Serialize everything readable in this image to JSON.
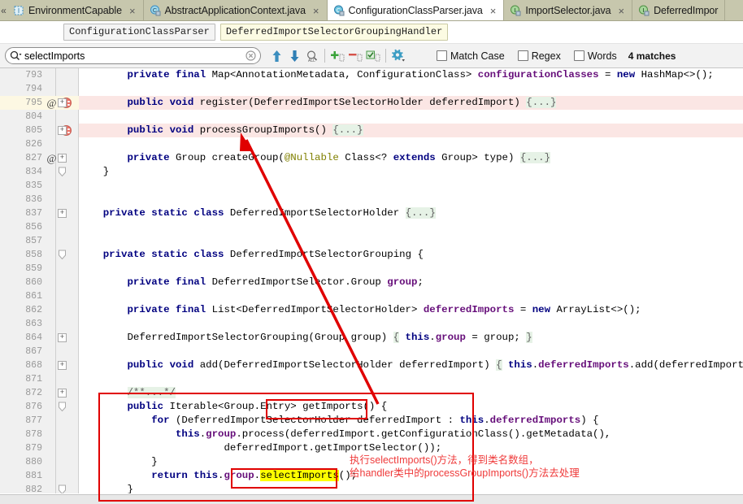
{
  "window": {
    "app": "IntelliJ IDEA Editor",
    "file": "ConfigurationClassParser.java"
  },
  "tabbar": {
    "overflow_left": "«",
    "tabs": [
      {
        "label": "EnvironmentCapable",
        "icon": "interface-icon",
        "active": false,
        "close": "×"
      },
      {
        "label": "AbstractApplicationContext.java",
        "icon": "class-icon",
        "active": false,
        "close": "×"
      },
      {
        "label": "ConfigurationClassParser.java",
        "icon": "class-icon",
        "active": true,
        "close": "×"
      },
      {
        "label": "ImportSelector.java",
        "icon": "interface-icon",
        "active": false,
        "close": "×"
      },
      {
        "label": "DeferredImpor",
        "icon": "interface-icon",
        "active": false,
        "close": ""
      }
    ]
  },
  "breadcrumb": {
    "items": [
      {
        "label": "ConfigurationClassParser",
        "highlight": false
      },
      {
        "label": "DeferredImportSelectorGroupingHandler",
        "highlight": true
      }
    ]
  },
  "findbar": {
    "search_value": "selectImports",
    "search_placeholder": "Search",
    "clear_title": "Clear",
    "buttons": [
      {
        "name": "find-previous-button",
        "glyph": "↑"
      },
      {
        "name": "find-next-button",
        "glyph": "↓"
      },
      {
        "name": "find-all-button",
        "glyph": "ALL"
      },
      {
        "name": "add-occurrence-button",
        "glyph": "+"
      },
      {
        "name": "remove-occurrence-button",
        "glyph": "−"
      },
      {
        "name": "select-all-occurrences-button",
        "glyph": "✓"
      },
      {
        "name": "find-settings-button",
        "glyph": "⚙"
      }
    ],
    "options": [
      {
        "label": "Match Case",
        "checked": false,
        "accesskey": "C"
      },
      {
        "label": "Regex",
        "checked": false,
        "accesskey": "g"
      },
      {
        "label": "Words",
        "checked": false,
        "accesskey": "r"
      }
    ],
    "match_count": "4 matches"
  },
  "editor": {
    "colors": {
      "keyword": "#000080",
      "field": "#660e7a",
      "annotation": "#808000",
      "folded": "#e6f2e6",
      "caret_row": "#fdf8e3",
      "modified_row": "#fbe6e4",
      "search_hit": "#ffff00",
      "annotation_red": "#ef3b3b"
    },
    "lines": [
      {
        "num": "793",
        "at": false,
        "override": false,
        "fold": "",
        "caret": false,
        "pinkbg": 0,
        "tokens": [
          {
            "t": "        ",
            "c": "plain"
          },
          {
            "t": "private",
            "c": "kw"
          },
          {
            "t": " ",
            "c": "plain"
          },
          {
            "t": "final",
            "c": "kw"
          },
          {
            "t": " Map<AnnotationMetadata, ConfigurationClass> ",
            "c": "plain"
          },
          {
            "t": "configurationClasses",
            "c": "fld"
          },
          {
            "t": " = ",
            "c": "plain"
          },
          {
            "t": "new",
            "c": "kw"
          },
          {
            "t": " HashMap<>();",
            "c": "plain"
          }
        ]
      },
      {
        "num": "794",
        "at": false,
        "override": false,
        "fold": "",
        "caret": false,
        "pinkbg": 0,
        "tokens": []
      },
      {
        "num": "795",
        "at": true,
        "override": true,
        "fold": "+",
        "caret": true,
        "pinkbg": 817,
        "tokens": [
          {
            "t": "        ",
            "c": "plain"
          },
          {
            "t": "public",
            "c": "kw"
          },
          {
            "t": " ",
            "c": "plain"
          },
          {
            "t": "void",
            "c": "kw"
          },
          {
            "t": " register(DeferredImportSelectorHolder deferredImport) ",
            "c": "plain"
          },
          {
            "t": "{...}",
            "c": "fold-ph"
          }
        ]
      },
      {
        "num": "804",
        "at": false,
        "override": false,
        "fold": "",
        "caret": false,
        "pinkbg": 0,
        "tokens": []
      },
      {
        "num": "805",
        "at": false,
        "override": true,
        "fold": "+",
        "caret": false,
        "pinkbg": 817,
        "tokens": [
          {
            "t": "        ",
            "c": "plain"
          },
          {
            "t": "public",
            "c": "kw"
          },
          {
            "t": " ",
            "c": "plain"
          },
          {
            "t": "void",
            "c": "kw"
          },
          {
            "t": " processGroupImports() ",
            "c": "plain"
          },
          {
            "t": "{...}",
            "c": "fold-ph"
          }
        ]
      },
      {
        "num": "826",
        "at": false,
        "override": false,
        "fold": "",
        "caret": false,
        "pinkbg": 0,
        "tokens": []
      },
      {
        "num": "827",
        "at": true,
        "override": false,
        "fold": "+",
        "caret": false,
        "pinkbg": 0,
        "tokens": [
          {
            "t": "        ",
            "c": "plain"
          },
          {
            "t": "private",
            "c": "kw"
          },
          {
            "t": " Group createGroup(",
            "c": "plain"
          },
          {
            "t": "@Nullable",
            "c": "anno"
          },
          {
            "t": " Class<? ",
            "c": "plain"
          },
          {
            "t": "extends",
            "c": "kw"
          },
          {
            "t": " Group> type) ",
            "c": "plain"
          },
          {
            "t": "{...}",
            "c": "fold-ph"
          }
        ]
      },
      {
        "num": "834",
        "at": false,
        "override": false,
        "fold": "collapse",
        "caret": false,
        "pinkbg": 0,
        "tokens": [
          {
            "t": "    }",
            "c": "plain"
          }
        ]
      },
      {
        "num": "835",
        "at": false,
        "override": false,
        "fold": "",
        "caret": false,
        "pinkbg": 0,
        "tokens": []
      },
      {
        "num": "836",
        "at": false,
        "override": false,
        "fold": "",
        "caret": false,
        "pinkbg": 0,
        "tokens": []
      },
      {
        "num": "837",
        "at": false,
        "override": false,
        "fold": "+",
        "caret": false,
        "pinkbg": 0,
        "tokens": [
          {
            "t": "    ",
            "c": "plain"
          },
          {
            "t": "private",
            "c": "kw"
          },
          {
            "t": " ",
            "c": "plain"
          },
          {
            "t": "static",
            "c": "kw"
          },
          {
            "t": " ",
            "c": "plain"
          },
          {
            "t": "class",
            "c": "kw"
          },
          {
            "t": " DeferredImportSelectorHolder ",
            "c": "plain"
          },
          {
            "t": "{...}",
            "c": "fold-ph"
          }
        ]
      },
      {
        "num": "856",
        "at": false,
        "override": false,
        "fold": "",
        "caret": false,
        "pinkbg": 0,
        "tokens": []
      },
      {
        "num": "857",
        "at": false,
        "override": false,
        "fold": "",
        "caret": false,
        "pinkbg": 0,
        "tokens": []
      },
      {
        "num": "858",
        "at": false,
        "override": false,
        "fold": "collapse",
        "caret": false,
        "pinkbg": 0,
        "tokens": [
          {
            "t": "    ",
            "c": "plain"
          },
          {
            "t": "private",
            "c": "kw"
          },
          {
            "t": " ",
            "c": "plain"
          },
          {
            "t": "static",
            "c": "kw"
          },
          {
            "t": " ",
            "c": "plain"
          },
          {
            "t": "class",
            "c": "kw"
          },
          {
            "t": " DeferredImportSelectorGrouping {",
            "c": "plain"
          }
        ]
      },
      {
        "num": "859",
        "at": false,
        "override": false,
        "fold": "",
        "caret": false,
        "pinkbg": 0,
        "tokens": []
      },
      {
        "num": "860",
        "at": false,
        "override": false,
        "fold": "",
        "caret": false,
        "pinkbg": 0,
        "tokens": [
          {
            "t": "        ",
            "c": "plain"
          },
          {
            "t": "private",
            "c": "kw"
          },
          {
            "t": " ",
            "c": "plain"
          },
          {
            "t": "final",
            "c": "kw"
          },
          {
            "t": " DeferredImportSelector.Group ",
            "c": "plain"
          },
          {
            "t": "group",
            "c": "fld"
          },
          {
            "t": ";",
            "c": "plain"
          }
        ]
      },
      {
        "num": "861",
        "at": false,
        "override": false,
        "fold": "",
        "caret": false,
        "pinkbg": 0,
        "tokens": []
      },
      {
        "num": "862",
        "at": false,
        "override": false,
        "fold": "",
        "caret": false,
        "pinkbg": 0,
        "tokens": [
          {
            "t": "        ",
            "c": "plain"
          },
          {
            "t": "private",
            "c": "kw"
          },
          {
            "t": " ",
            "c": "plain"
          },
          {
            "t": "final",
            "c": "kw"
          },
          {
            "t": " List<DeferredImportSelectorHolder> ",
            "c": "plain"
          },
          {
            "t": "deferredImports",
            "c": "fld"
          },
          {
            "t": " = ",
            "c": "plain"
          },
          {
            "t": "new",
            "c": "kw"
          },
          {
            "t": " ArrayList<>();",
            "c": "plain"
          }
        ]
      },
      {
        "num": "863",
        "at": false,
        "override": false,
        "fold": "",
        "caret": false,
        "pinkbg": 0,
        "tokens": []
      },
      {
        "num": "864",
        "at": false,
        "override": false,
        "fold": "+",
        "caret": false,
        "pinkbg": 0,
        "tokens": [
          {
            "t": "        DeferredImportSelectorGrouping(Group group) ",
            "c": "plain"
          },
          {
            "t": "{",
            "c": "fold-ph"
          },
          {
            "t": " ",
            "c": "plain"
          },
          {
            "t": "this",
            "c": "kw"
          },
          {
            "t": ".",
            "c": "plain"
          },
          {
            "t": "group",
            "c": "fld"
          },
          {
            "t": " = group; ",
            "c": "plain"
          },
          {
            "t": "}",
            "c": "fold-ph"
          }
        ]
      },
      {
        "num": "867",
        "at": false,
        "override": false,
        "fold": "",
        "caret": false,
        "pinkbg": 0,
        "tokens": []
      },
      {
        "num": "868",
        "at": false,
        "override": false,
        "fold": "+",
        "caret": false,
        "pinkbg": 0,
        "tokens": [
          {
            "t": "        ",
            "c": "plain"
          },
          {
            "t": "public",
            "c": "kw"
          },
          {
            "t": " ",
            "c": "plain"
          },
          {
            "t": "void",
            "c": "kw"
          },
          {
            "t": " add(DeferredImportSelectorHolder deferredImport) ",
            "c": "plain"
          },
          {
            "t": "{",
            "c": "fold-ph"
          },
          {
            "t": " ",
            "c": "plain"
          },
          {
            "t": "this",
            "c": "kw"
          },
          {
            "t": ".",
            "c": "plain"
          },
          {
            "t": "deferredImports",
            "c": "fld"
          },
          {
            "t": ".add(deferredImport); ",
            "c": "plain"
          },
          {
            "t": "}",
            "c": "fold-ph"
          }
        ]
      },
      {
        "num": "871",
        "at": false,
        "override": false,
        "fold": "",
        "caret": false,
        "pinkbg": 0,
        "tokens": []
      },
      {
        "num": "872",
        "at": false,
        "override": false,
        "fold": "+",
        "caret": false,
        "pinkbg": 0,
        "tokens": [
          {
            "t": "        ",
            "c": "plain"
          },
          {
            "t": "/**...*/",
            "c": "fold-ph"
          }
        ]
      },
      {
        "num": "876",
        "at": false,
        "override": false,
        "fold": "collapse",
        "caret": false,
        "pinkbg": 0,
        "tokens": [
          {
            "t": "        ",
            "c": "plain"
          },
          {
            "t": "public",
            "c": "kw"
          },
          {
            "t": " Iterable<Group.Entry> getImports() {",
            "c": "plain"
          }
        ]
      },
      {
        "num": "877",
        "at": false,
        "override": false,
        "fold": "",
        "caret": false,
        "pinkbg": 0,
        "tokens": [
          {
            "t": "            ",
            "c": "plain"
          },
          {
            "t": "for",
            "c": "kw"
          },
          {
            "t": " (DeferredImportSelectorHolder deferredImport : ",
            "c": "plain"
          },
          {
            "t": "this",
            "c": "kw"
          },
          {
            "t": ".",
            "c": "plain"
          },
          {
            "t": "deferredImports",
            "c": "fld"
          },
          {
            "t": ") {",
            "c": "plain"
          }
        ]
      },
      {
        "num": "878",
        "at": false,
        "override": false,
        "fold": "",
        "caret": false,
        "pinkbg": 0,
        "tokens": [
          {
            "t": "                ",
            "c": "plain"
          },
          {
            "t": "this",
            "c": "kw"
          },
          {
            "t": ".",
            "c": "plain"
          },
          {
            "t": "group",
            "c": "fld"
          },
          {
            "t": ".process(deferredImport.getConfigurationClass().getMetadata(),",
            "c": "plain"
          }
        ]
      },
      {
        "num": "879",
        "at": false,
        "override": false,
        "fold": "",
        "caret": false,
        "pinkbg": 0,
        "tokens": [
          {
            "t": "                        deferredImport.getImportSelector());",
            "c": "plain"
          }
        ]
      },
      {
        "num": "880",
        "at": false,
        "override": false,
        "fold": "",
        "caret": false,
        "pinkbg": 0,
        "tokens": [
          {
            "t": "            }",
            "c": "plain"
          }
        ]
      },
      {
        "num": "881",
        "at": false,
        "override": false,
        "fold": "",
        "caret": false,
        "pinkbg": 0,
        "tokens": [
          {
            "t": "            ",
            "c": "plain"
          },
          {
            "t": "return",
            "c": "kw"
          },
          {
            "t": " ",
            "c": "plain"
          },
          {
            "t": "this",
            "c": "kw"
          },
          {
            "t": ".",
            "c": "plain"
          },
          {
            "t": "group",
            "c": "fld"
          },
          {
            "t": ".",
            "c": "plain"
          },
          {
            "t": "selectImports",
            "c": "hit"
          },
          {
            "t": "();",
            "c": "plain"
          }
        ]
      },
      {
        "num": "882",
        "at": false,
        "override": false,
        "fold": "collapse",
        "caret": false,
        "pinkbg": 0,
        "tokens": [
          {
            "t": "        }",
            "c": "plain"
          }
        ]
      }
    ]
  },
  "annotations": {
    "text_line1": "执行selectImports()方法，得到类名数组，",
    "text_line2": "给handler类中的processGroupImports()方法去处理",
    "arrow_label": "arrow-from-getImports-to-processGroupImports",
    "box_method_signature": "getImports()",
    "box_selected_call": "selectImports();",
    "color": "#e00000"
  }
}
